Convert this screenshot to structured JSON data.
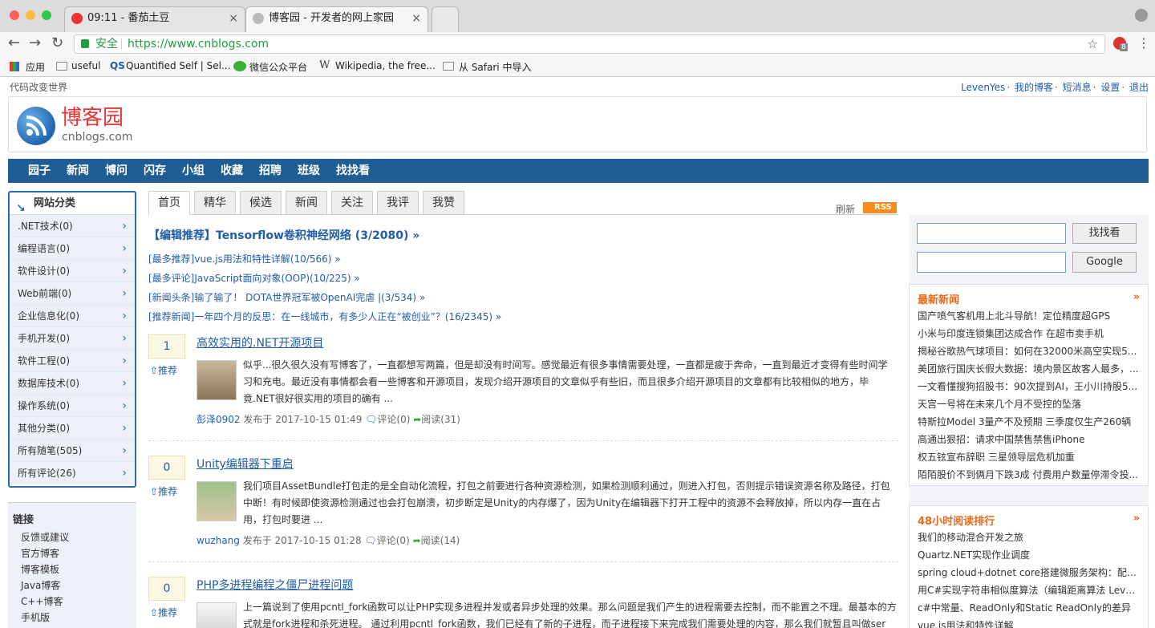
{
  "browser": {
    "tabs": [
      {
        "title": "09:11 - 番茄土豆",
        "close": "×"
      },
      {
        "title": "博客园 - 开发者的网上家园",
        "close": "×"
      }
    ],
    "secure_label": "安全",
    "url": "https://www.cnblogs.com",
    "bookmarks": [
      "应用",
      "useful",
      "Quantified Self | Sel...",
      "微信公众平台",
      "Wikipedia, the free...",
      "从 Safari 中导入"
    ],
    "ext_badge": "8"
  },
  "site": {
    "slogan": "代码改变世界",
    "user_links": [
      "LevenYes",
      "我的博客",
      "短消息",
      "设置",
      "退出"
    ],
    "logo_text": "博客园",
    "logo_sub": "cnblogs.com",
    "nav": [
      "园子",
      "新闻",
      "博问",
      "闪存",
      "小组",
      "收藏",
      "招聘",
      "班级",
      "找找看"
    ]
  },
  "left": {
    "cat_title": "网站分类",
    "categories": [
      ".NET技术(0)",
      "编程语言(0)",
      "软件设计(0)",
      "Web前端(0)",
      "企业信息化(0)",
      "手机开发(0)",
      "软件工程(0)",
      "数据库技术(0)",
      "操作系统(0)",
      "其他分类(0)",
      "所有随笔(505)",
      "所有评论(26)"
    ],
    "links_title": "链接",
    "links": [
      "反馈或建议",
      "官方博客",
      "博客模板",
      "Java博客",
      "C++博客",
      "手机版"
    ]
  },
  "center": {
    "tabs": [
      "首页",
      "精华",
      "候选",
      "新闻",
      "关注",
      "我评",
      "我赞"
    ],
    "refresh": "刷新",
    "rss": "RSS",
    "headline_main": "【编辑推荐】Tensorflow卷积神经网络 (3/2080) »",
    "headlines": [
      "[最多推荐]vue.js用法和特性详解(10/566) »",
      "[最多评论]JavaScript面向对象(OOP)(10/225) »",
      "[新闻头条]输了输了！ DOTA世界冠军被OpenAI完虐 |(3/534) »",
      "[推荐新闻]一年四个月的反思：在一线城市，有多少人正在“被创业”？(16/2345) »"
    ],
    "vote_label": "推荐",
    "posts": [
      {
        "votes": "1",
        "title": "高效实用的.NET开源项目",
        "summary": "似乎...很久很久没有写博客了，一直都想写两篇，但是却没有时间写。感觉最近有很多事情需要处理，一直都是疲于奔命，一直到最近才变得有些时间学习和充电。最近没有事情都会看一些博客和开源项目，发现介绍开源项目的文章似乎有些旧，而且很多介绍开源项目的文章都有比较相似的地方，毕竟.NET很好很实用的项目的确有 ...",
        "author": "彭泽0902",
        "posted": "发布于 2017-10-15 01:49",
        "comments": "评论(0)",
        "reads": "阅读(31)"
      },
      {
        "votes": "0",
        "title": "Unity编辑器下重启",
        "summary": "我们项目AssetBundle打包走的是全自动化流程，打包之前要进行各种资源检测，如果检测顺利通过，则进入打包，否则提示错误资源名称及路径，打包中断！有时候即使资源检测通过也会打包崩溃，初步断定是Unity的内存爆了，因为Unity在编辑器下打开工程中的资源不会释放掉，所以内存一直在占用，打包时要进 ...",
        "author": "wuzhang",
        "posted": "发布于 2017-10-15 01:28",
        "comments": "评论(0)",
        "reads": "阅读(14)"
      },
      {
        "votes": "0",
        "title": "PHP多进程编程之僵尸进程问题",
        "summary": "上一篇说到了使用pcntl_fork函数可以让PHP实现多进程并发或者异步处理的效果。那么问题是我们产生的进程需要去控制，而不能置之不理。最基本的方式就是fork进程和杀死进程。 通过利用pcntl_fork函数，我们已经有了新的子进程，而子进程接下来完成我们需要处理的内容，那么我们就暂且叫做ser ...",
        "author": "",
        "posted": "",
        "comments": "",
        "reads": ""
      }
    ]
  },
  "right": {
    "search_btn": "找找看",
    "google_btn": "Google",
    "news_title": "最新新闻",
    "news_more": "»",
    "news": [
      "国产喷气客机用上北斗导航！定位精度超GPS",
      "小米与印度连锁集团达成合作 在超市卖手机",
      "揭秘谷歌热气球项目：如何在32000米高空实现5...",
      "美团旅行国庆长假大数据：境内景区故客人最多，...",
      "一文看懂搜狗招股书：90次提到AI，王小川持股5...",
      "天宫一号将在未来几个月不受控的坠落",
      "特斯拉Model 3量产不及预期 三季度仅生产260辆",
      "高通出狠招：请求中国禁售禁售iPhone",
      "权五铉宣布辞职 三星领导层危机加重",
      "陌陌股价不到俩月下跌3成 付费用户数量停滞令投..."
    ],
    "top_title": "48小时阅读排行",
    "top_more": "»",
    "top": [
      "我们的移动混合开发之旅",
      "Quartz.NET实现作业调度",
      "spring cloud+dotnet core搭建微服务架构：配置...",
      "用C#实现字符串相似度算法（编辑距离算法 Leve...",
      "c#中常量、ReadOnly和Static ReadOnly的差异",
      "vue.js用法和特性详解"
    ]
  }
}
